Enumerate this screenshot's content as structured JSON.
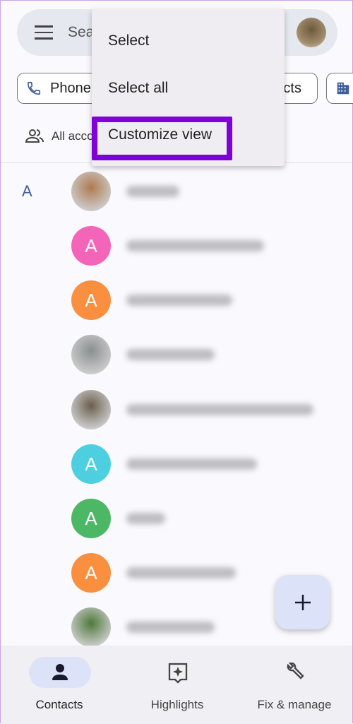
{
  "search": {
    "placeholder": "Search contacts"
  },
  "chips": [
    {
      "label": "Phone"
    },
    {
      "label": "Contacts"
    }
  ],
  "account_filter": "All accounts",
  "section_letter": "A",
  "contacts": [
    {
      "type": "photo",
      "color": "#b07a50"
    },
    {
      "type": "initial",
      "initial": "A",
      "color": "#f464b8"
    },
    {
      "type": "initial",
      "initial": "A",
      "color": "#f98f3f"
    },
    {
      "type": "photo",
      "color": "#8a8f90"
    },
    {
      "type": "photo",
      "color": "#6b5f4e"
    },
    {
      "type": "initial",
      "initial": "A",
      "color": "#4dcfe0"
    },
    {
      "type": "initial",
      "initial": "A",
      "color": "#4cb866"
    },
    {
      "type": "initial",
      "initial": "A",
      "color": "#f98f3f"
    },
    {
      "type": "photo",
      "color": "#4f7a3a"
    }
  ],
  "menu": {
    "items": [
      "Select",
      "Select all",
      "Customize view"
    ],
    "highlighted": "Customize view",
    "highlight_color": "#8000d8"
  },
  "nav": {
    "items": [
      {
        "label": "Contacts",
        "icon": "person-icon",
        "active": true
      },
      {
        "label": "Highlights",
        "icon": "sparkle-icon"
      },
      {
        "label": "Fix & manage",
        "icon": "wrench-icon"
      }
    ]
  }
}
